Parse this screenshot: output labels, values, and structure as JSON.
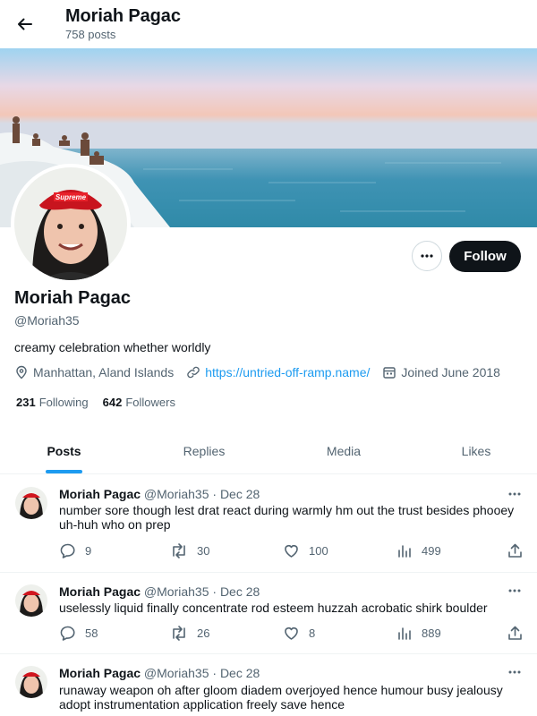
{
  "header": {
    "name": "Moriah Pagac",
    "posts_count": "758 posts"
  },
  "profile": {
    "name": "Moriah Pagac",
    "handle": "@Moriah35",
    "bio": "creamy celebration whether worldly",
    "location": "Manhattan, Aland Islands",
    "website": "https://untried-off-ramp.name/",
    "joined": "Joined June 2018",
    "following_count": "231",
    "following_label": "Following",
    "followers_count": "642",
    "followers_label": "Followers",
    "follow_label": "Follow"
  },
  "tabs": [
    {
      "label": "Posts",
      "active": true
    },
    {
      "label": "Replies",
      "active": false
    },
    {
      "label": "Media",
      "active": false
    },
    {
      "label": "Likes",
      "active": false
    }
  ],
  "posts": [
    {
      "name": "Moriah Pagac",
      "handle": "@Moriah35",
      "date": "· Dec 28",
      "text": "number sore though lest drat react during warmly hm out the trust besides phooey uh-huh who on prep",
      "replies": "9",
      "reposts": "30",
      "likes": "100",
      "views": "499"
    },
    {
      "name": "Moriah Pagac",
      "handle": "@Moriah35",
      "date": "· Dec 28",
      "text": "uselessly liquid finally concentrate rod esteem huzzah acrobatic shirk boulder",
      "replies": "58",
      "reposts": "26",
      "likes": "8",
      "views": "889"
    },
    {
      "name": "Moriah Pagac",
      "handle": "@Moriah35",
      "date": "· Dec 28",
      "text": "runaway weapon oh after gloom diadem overjoyed hence humour busy jealousy adopt instrumentation application freely save hence",
      "replies": "",
      "reposts": "",
      "likes": "",
      "views": ""
    }
  ],
  "colors": {
    "accent": "#1d9bf0",
    "text": "#0f1419",
    "muted": "#536471",
    "follow_bg": "#0f1419"
  },
  "icons": [
    "back-arrow-icon",
    "more-icon",
    "location-icon",
    "link-icon",
    "calendar-icon",
    "reply-icon",
    "repost-icon",
    "like-icon",
    "views-icon",
    "share-icon"
  ]
}
